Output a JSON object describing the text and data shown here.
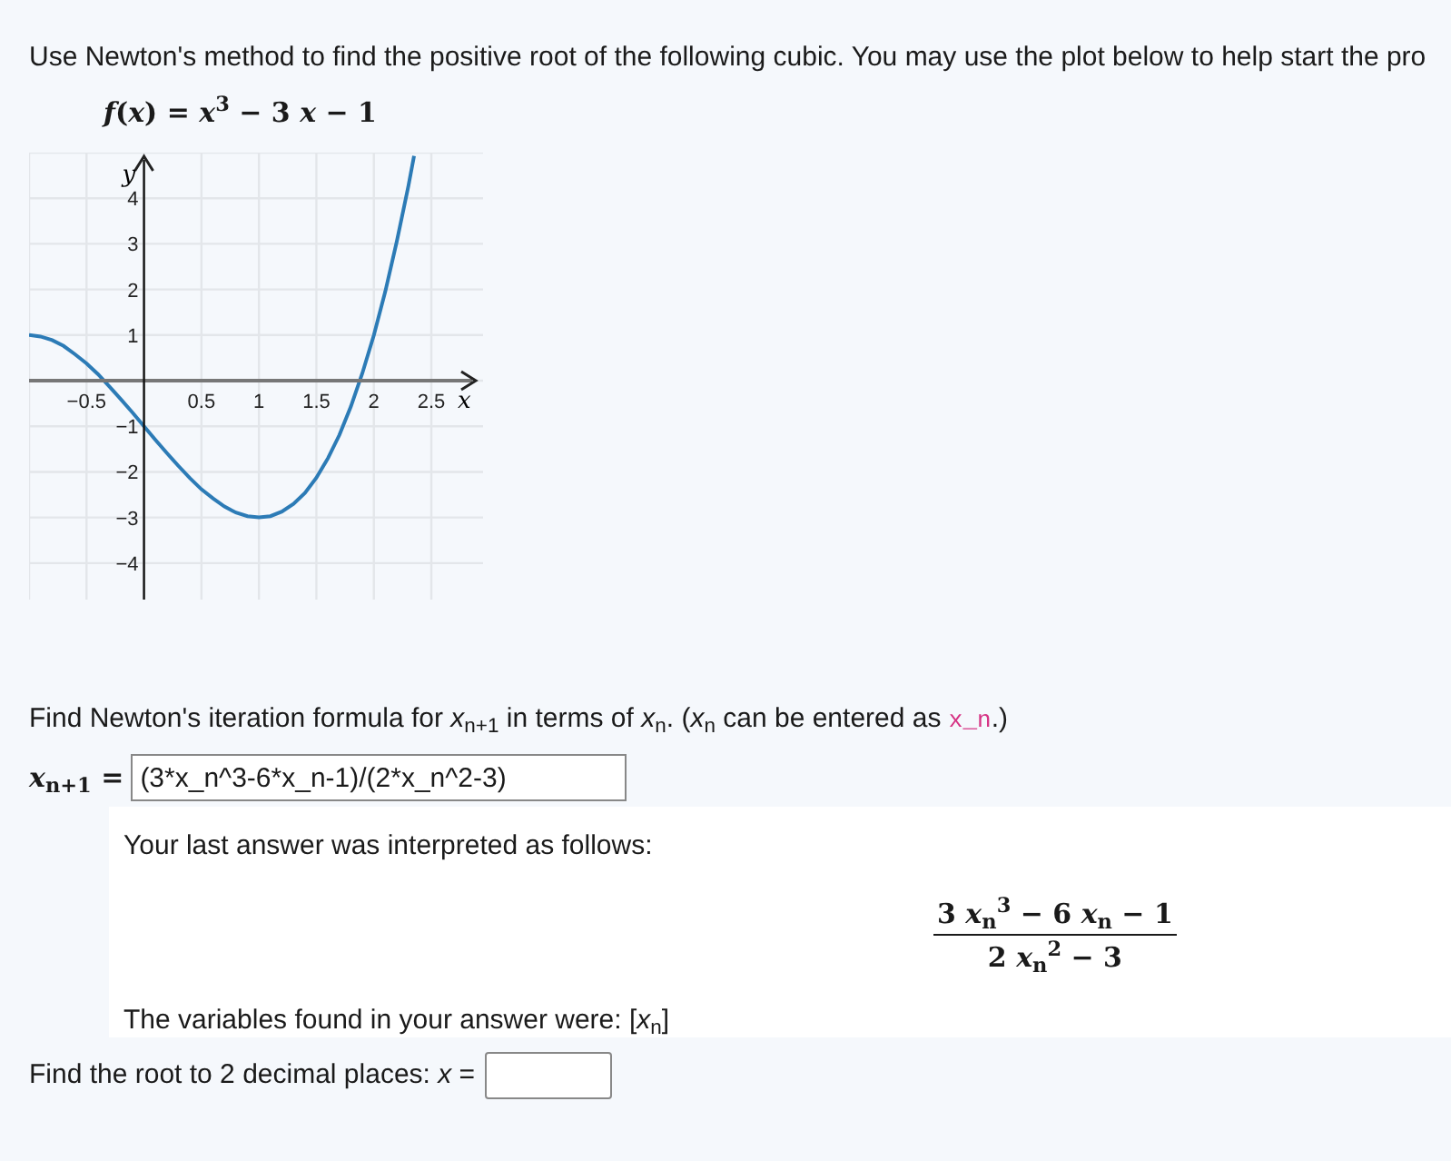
{
  "intro": "Use Newton's method to find the positive root of the following cubic. You may use the plot below to help start the pro",
  "function": "*f*(*x*) = *x*$^{3}$ − 3 *x* − 1",
  "plot": {
    "chart_data": {
      "type": "line",
      "xlabel": "x",
      "ylabel": "y",
      "grid": true,
      "xlim": [
        -1,
        2.95
      ],
      "ylim": [
        -4.8,
        5
      ],
      "xticks": [
        {
          "value": -0.5,
          "label": "−0.5"
        },
        0.5,
        1,
        1.5,
        2,
        2.5
      ],
      "yticks": [
        {
          "value": -4,
          "label": "−4"
        },
        {
          "value": -3,
          "label": "−3"
        },
        {
          "value": -2,
          "label": "−2"
        },
        {
          "value": -1,
          "label": "−1"
        },
        1,
        2,
        3,
        4
      ],
      "x": [
        -1,
        -0.9,
        -0.8,
        -0.7,
        -0.6,
        -0.5,
        -0.4,
        -0.3,
        -0.2,
        -0.1,
        0,
        0.1,
        0.2,
        0.3,
        0.4,
        0.5,
        0.6,
        0.7,
        0.8,
        0.9,
        1,
        1.1,
        1.2,
        1.3,
        1.4,
        1.5,
        1.6,
        1.7,
        1.8,
        1.9,
        2,
        2.1,
        2.2,
        2.3,
        2.35
      ],
      "series": [
        {
          "color": "#2c7bb6",
          "values": [
            1,
            0.97,
            0.89,
            0.76,
            0.58,
            0.38,
            0.14,
            -0.13,
            -0.41,
            -0.7,
            -1,
            -1.3,
            -1.59,
            -1.87,
            -2.14,
            -2.38,
            -2.58,
            -2.76,
            -2.89,
            -2.97,
            -3,
            -2.97,
            -2.87,
            -2.7,
            -2.46,
            -2.13,
            -1.7,
            -1.19,
            -0.57,
            0.16,
            1,
            1.96,
            3.05,
            4.27,
            4.93
          ]
        }
      ]
    }
  },
  "question": {
    "before": "Find Newton's iteration formula for *x*$_{n+1}$ in terms of *x*$_{n}$. (*x*$_{n}$ can be entered as ",
    "code": "x_n",
    "after": ".)"
  },
  "answer": {
    "label": "*x*$_{n+1}$ =",
    "value": "(3*x_n^3-6*x_n-1)/(2*x_n^2-3)"
  },
  "feedback": {
    "heading": "Your last answer was interpreted as follows:",
    "numerator": "3 *x*$_{n}$$^{3}$ − 6 *x*$_{n}$ − 1",
    "denominator": "2 *x*$_{n}$$^{2}$ − 3",
    "variables": "The variables found in your answer were: [*x*$_{n}$]"
  },
  "final": {
    "label": "Find the root to 2 decimal places: *x* ="
  }
}
